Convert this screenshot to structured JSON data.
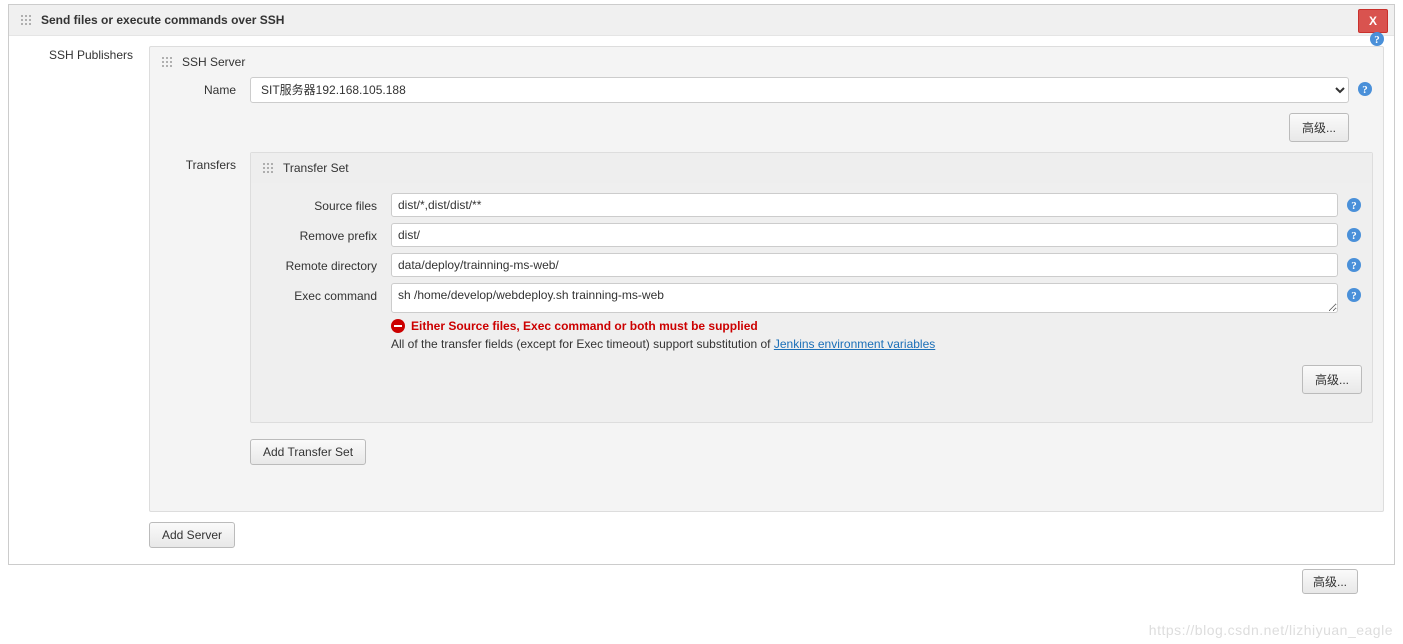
{
  "section": {
    "title": "Send files or execute commands over SSH",
    "delete_label": "X"
  },
  "publishers": {
    "label": "SSH Publishers"
  },
  "ssh_server": {
    "title": "SSH Server",
    "name_label": "Name",
    "name_value": "SIT服务器192.168.105.188",
    "advanced_label": "高级..."
  },
  "transfers": {
    "label": "Transfers",
    "set_title": "Transfer Set",
    "source_files_label": "Source files",
    "source_files_value": "dist/*,dist/dist/**",
    "remove_prefix_label": "Remove prefix",
    "remove_prefix_value": "dist/",
    "remote_dir_label": "Remote directory",
    "remote_dir_value": "data/deploy/trainning-ms-web/",
    "exec_cmd_label": "Exec command",
    "exec_cmd_value": "sh /home/develop/webdeploy.sh trainning-ms-web",
    "error_msg": "Either Source files, Exec command or both must be supplied",
    "hint_prefix": "All of the transfer fields (except for Exec timeout) support substitution of ",
    "hint_link": "Jenkins environment variables",
    "advanced_label": "高级...",
    "add_set_label": "Add Transfer Set"
  },
  "footer": {
    "add_server_label": "Add Server",
    "advanced_label": "高级..."
  },
  "watermark": "https://blog.csdn.net/lizhiyuan_eagle"
}
